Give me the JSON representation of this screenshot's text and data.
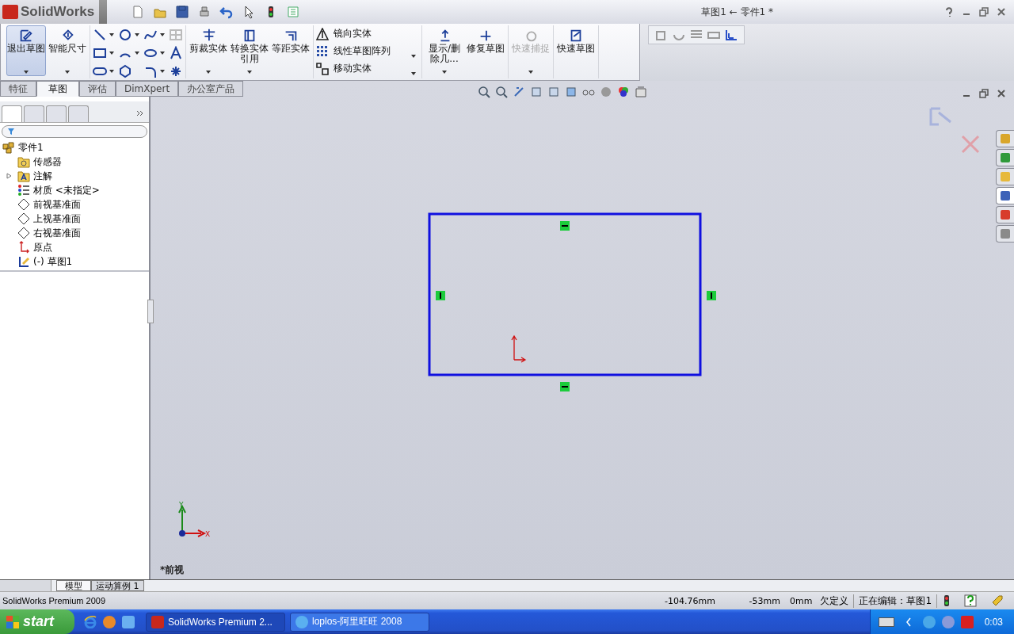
{
  "app_title": "SolidWorks",
  "document_title": "草图1 ← 零件1 *",
  "ribbon": {
    "groups": [
      {
        "kind": "buttons",
        "items": [
          {
            "label": "退出草图",
            "active": true,
            "disabled": false,
            "menu": true
          },
          {
            "label": "智能尺寸",
            "active": false,
            "disabled": false,
            "menu": true
          }
        ]
      },
      {
        "kind": "sketch_tools"
      },
      {
        "kind": "buttons",
        "items": [
          {
            "label": "剪裁实体",
            "active": false,
            "disabled": false,
            "menu": true
          },
          {
            "label": "转换实体引用",
            "active": false,
            "disabled": false,
            "menu": true
          },
          {
            "label": "等距实体",
            "active": false,
            "disabled": false,
            "menu": false
          }
        ]
      },
      {
        "kind": "list",
        "items": [
          {
            "label": "镜向实体",
            "menu": false
          },
          {
            "label": "线性草图阵列",
            "menu": true
          },
          {
            "label": "移动实体",
            "menu": true
          }
        ]
      },
      {
        "kind": "buttons",
        "items": [
          {
            "label": "显示/删除几...",
            "active": false,
            "disabled": false,
            "menu": true
          },
          {
            "label": "修复草图",
            "active": false,
            "disabled": false,
            "menu": false
          }
        ]
      },
      {
        "kind": "buttons",
        "items": [
          {
            "label": "快速捕捉",
            "active": false,
            "disabled": true,
            "menu": true
          }
        ]
      },
      {
        "kind": "buttons",
        "items": [
          {
            "label": "快速草图",
            "active": false,
            "disabled": false,
            "menu": false
          }
        ]
      }
    ]
  },
  "tabs": [
    {
      "label": "特征",
      "selected": false
    },
    {
      "label": "草图",
      "selected": true
    },
    {
      "label": "评估",
      "selected": false
    },
    {
      "label": "DimXpert",
      "selected": false
    },
    {
      "label": "办公室产品",
      "selected": false
    }
  ],
  "feature_tree": {
    "root": "零件1",
    "children": [
      {
        "label": "传感器",
        "kind": "sensor",
        "expandable": false
      },
      {
        "label": "注解",
        "kind": "annotation",
        "expandable": true
      },
      {
        "label": "材质 <未指定>",
        "kind": "material",
        "expandable": false
      },
      {
        "label": "前视基准面",
        "kind": "plane",
        "expandable": false
      },
      {
        "label": "上视基准面",
        "kind": "plane",
        "expandable": false
      },
      {
        "label": "右视基准面",
        "kind": "plane",
        "expandable": false
      },
      {
        "label": "原点",
        "kind": "origin",
        "expandable": false
      },
      {
        "label": "(-) 草图1",
        "kind": "sketch",
        "expandable": false
      }
    ]
  },
  "triad": {
    "y_label": "Y",
    "x_label": "X"
  },
  "view_label": "*前视",
  "model_tabs": [
    {
      "label": "模型",
      "selected": true
    },
    {
      "label": "运动算例 1",
      "selected": false
    }
  ],
  "status_bar": {
    "app": "SolidWorks Premium 2009",
    "x": "-104.76mm",
    "y": "-53mm",
    "z": "0mm",
    "state": "欠定义",
    "editing": "正在编辑：草图1"
  },
  "taskbar": {
    "start": "start",
    "windows": [
      {
        "label": "SolidWorks Premium 2...",
        "selected": true
      },
      {
        "label": "loplos-阿里旺旺 2008",
        "selected": false
      }
    ],
    "clock": "0:03"
  }
}
